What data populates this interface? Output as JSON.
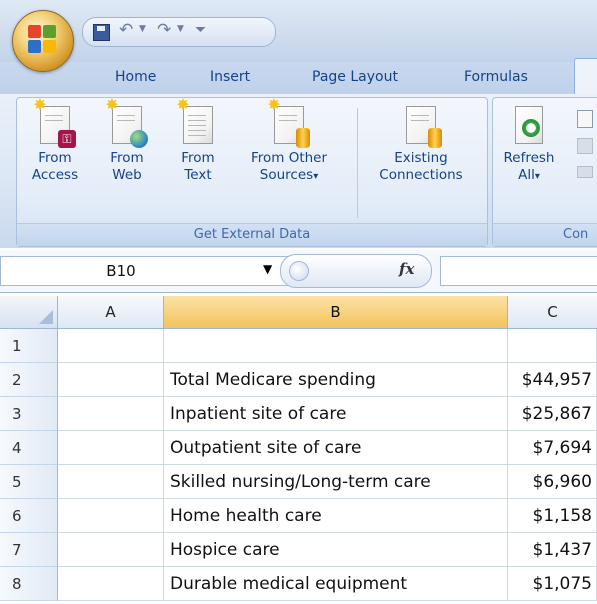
{
  "qat": {
    "save_icon": "save-icon",
    "undo_icon": "undo-icon",
    "redo_icon": "redo-icon",
    "customize_icon": "customize-qat-icon"
  },
  "tabs": [
    "Home",
    "Insert",
    "Page Layout",
    "Formulas"
  ],
  "ribbon": {
    "get_external_data": {
      "label": "Get External Data",
      "buttons": [
        {
          "line1": "From",
          "line2": "Access",
          "icon": "access-database-icon"
        },
        {
          "line1": "From",
          "line2": "Web",
          "icon": "web-globe-icon"
        },
        {
          "line1": "From",
          "line2": "Text",
          "icon": "text-file-icon"
        },
        {
          "line1": "From Other",
          "line2": "Sources",
          "icon": "database-icon"
        },
        {
          "line1": "Existing",
          "line2": "Connections",
          "icon": "connections-icon"
        }
      ],
      "dropdown_marker": "▾"
    },
    "connections": {
      "label": "Con",
      "refresh_line1": "Refresh",
      "refresh_line2": "All"
    }
  },
  "formula_bar": {
    "name_box": "B10",
    "fx_label": "fx",
    "formula": ""
  },
  "grid": {
    "columns": [
      "A",
      "B",
      "C"
    ],
    "selected_column": "B",
    "rows": [
      {
        "num": "1",
        "b": "",
        "c": ""
      },
      {
        "num": "2",
        "b": "Total Medicare spending",
        "c": "$44,957"
      },
      {
        "num": "3",
        "b": "Inpatient site of care",
        "c": "$25,867"
      },
      {
        "num": "4",
        "b": "Outpatient site of care",
        "c": "$7,694"
      },
      {
        "num": "5",
        "b": "Skilled nursing/Long-term care",
        "c": "$6,960"
      },
      {
        "num": "6",
        "b": "Home health care",
        "c": "$1,158"
      },
      {
        "num": "7",
        "b": "Hospice care",
        "c": "$1,437"
      },
      {
        "num": "8",
        "b": "Durable medical equipment",
        "c": "$1,075"
      }
    ]
  },
  "colors": {
    "ribbon_text": "#15428b",
    "selected_header": "#f3c35c",
    "group_label": "#3e6aaa"
  }
}
